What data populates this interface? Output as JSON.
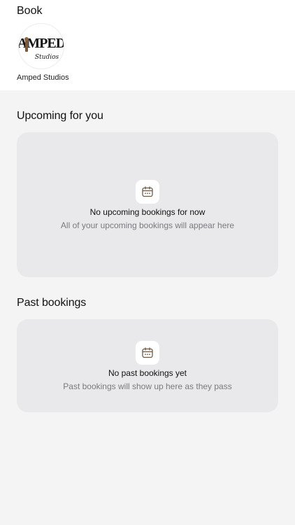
{
  "header": {
    "title": "Book"
  },
  "studio": {
    "name": "Amped Studios",
    "logo_text": "AMPED",
    "logo_script": "Studios"
  },
  "upcoming": {
    "title": "Upcoming for you",
    "empty_title": "No upcoming bookings for now",
    "empty_subtitle": "All of your upcoming bookings will appear here",
    "icon": "calendar-icon"
  },
  "past": {
    "title": "Past bookings",
    "empty_title": "No past bookings yet",
    "empty_subtitle": "Past bookings will show up here as they pass",
    "icon": "calendar-icon"
  },
  "colors": {
    "page_background": "#f4f4f5",
    "card_background": "#e9e9eb",
    "icon_stroke": "#6b5a47"
  }
}
